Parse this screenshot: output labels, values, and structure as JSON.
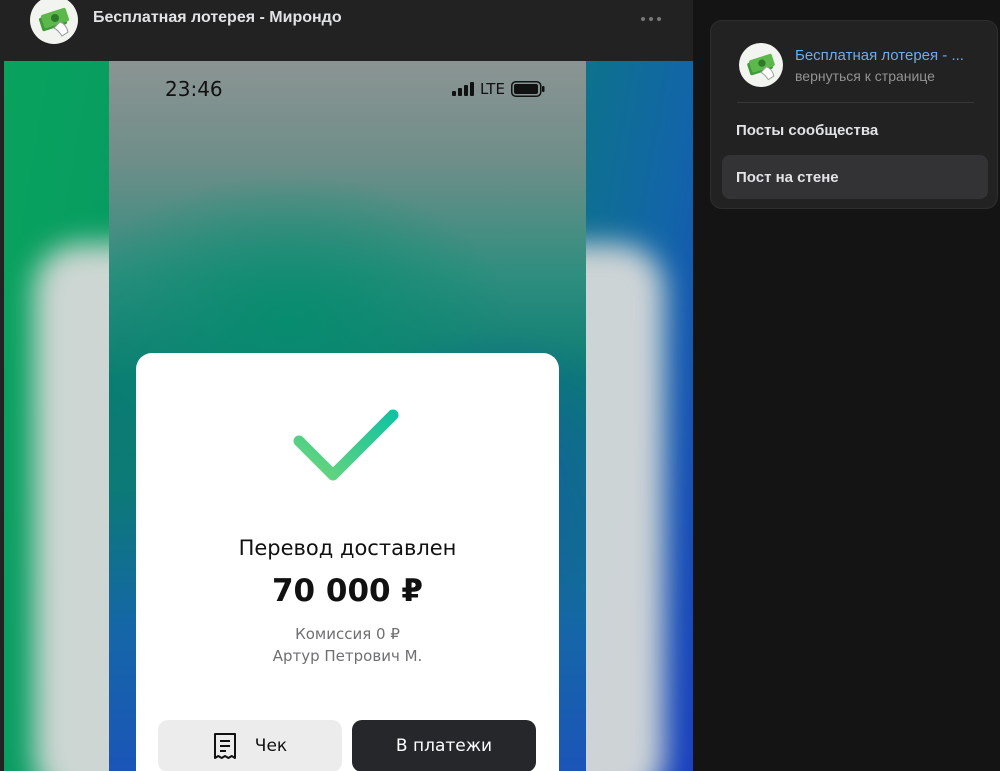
{
  "header": {
    "title": "Бесплатная лотерея - Мирондо",
    "more_icon": "more-horizontal-icon",
    "avatar_icon": "money-stack-hand-icon"
  },
  "screenshot": {
    "status_bar": {
      "time": "23:46",
      "network": "LTE",
      "signal_icon": "signal-bars-icon",
      "battery_icon": "battery-icon"
    },
    "card": {
      "icon": "checkmark-icon",
      "title": "Перевод доставлен",
      "amount": "70 000 ₽",
      "fee": "Комиссия 0 ₽",
      "recipient": "Артур Петрович М.",
      "receipt_button": "Чек",
      "receipt_icon": "receipt-icon",
      "payments_button": "В платежи"
    }
  },
  "sidebar": {
    "community_name": "Бесплатная лотерея - ...",
    "back_link": "вернуться к странице",
    "items": [
      {
        "label": "Посты сообщества",
        "active": false
      },
      {
        "label": "Пост на стене",
        "active": true
      }
    ]
  },
  "colors": {
    "link": "#71aaeb",
    "panel_bg": "#222222",
    "page_bg": "#141414",
    "check_green_start": "#6fd67a",
    "check_green_end": "#11c3a1"
  }
}
